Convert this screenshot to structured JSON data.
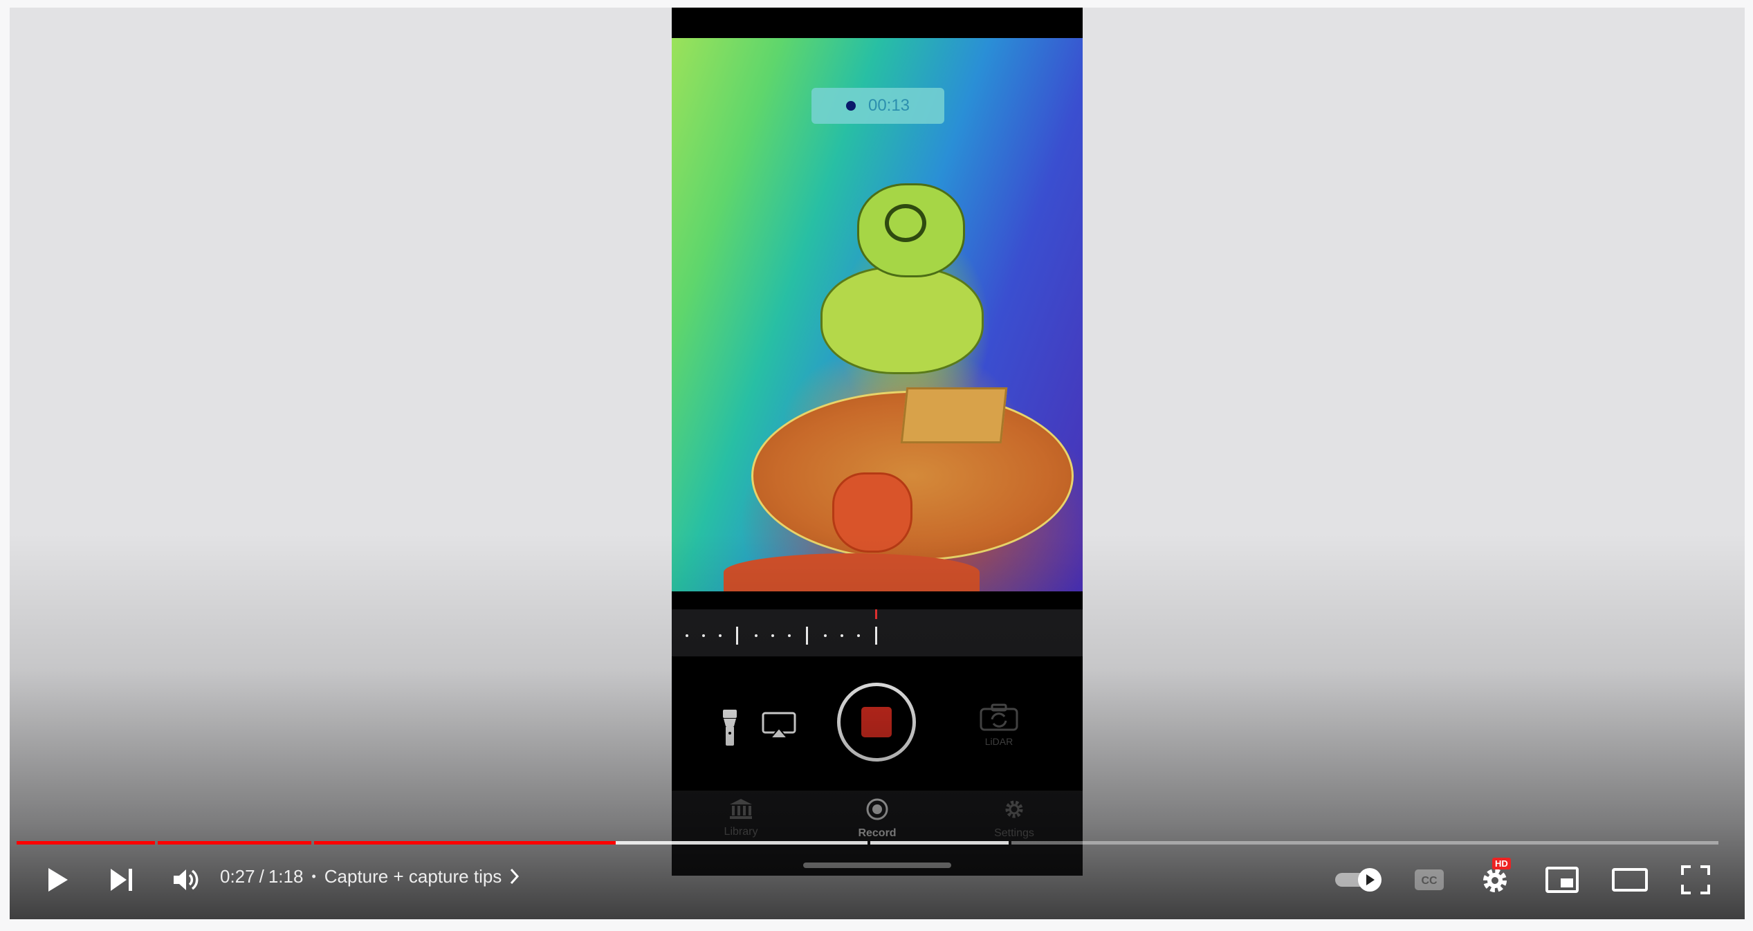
{
  "video": {
    "recording_timer": "00:13",
    "lidar_label": "LiDAR",
    "tabs": [
      {
        "label": "Library"
      },
      {
        "label": "Record"
      },
      {
        "label": "Settings"
      }
    ],
    "active_tab": "Record"
  },
  "player": {
    "current_time": "0:27",
    "time_separator": "/",
    "duration": "1:18",
    "chapter_separator": "•",
    "chapter_title": "Capture + capture tips",
    "progress_fraction": 0.346,
    "hd_badge": "HD",
    "accent_color": "#ff0000",
    "icons": [
      "play-icon",
      "next-icon",
      "volume-icon",
      "autoplay-toggle-icon",
      "captions-icon",
      "settings-icon",
      "miniplayer-icon",
      "theater-mode-icon",
      "fullscreen-icon"
    ]
  }
}
